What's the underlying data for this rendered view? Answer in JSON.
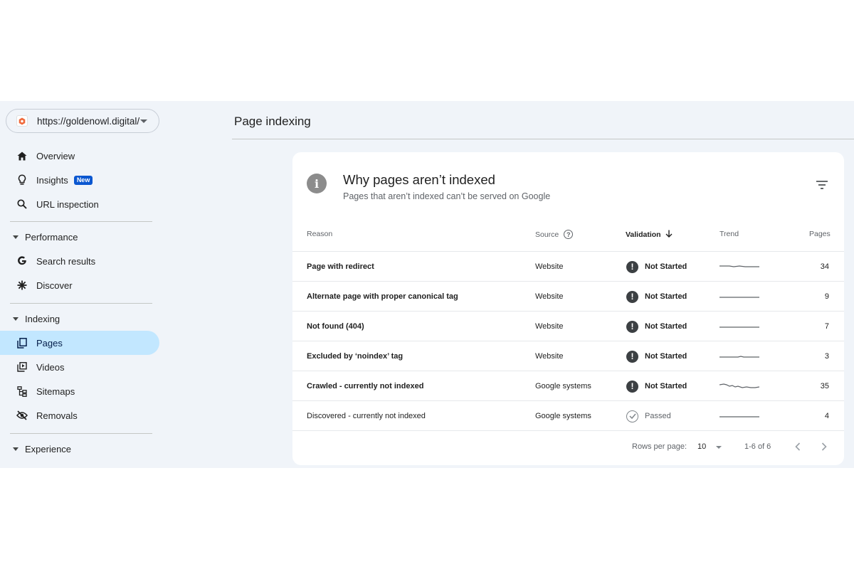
{
  "property": {
    "url": "https://goldenowl.digital/"
  },
  "sidebar": {
    "items": [
      {
        "label": "Overview",
        "icon": "home-icon"
      },
      {
        "label": "Insights",
        "icon": "lightbulb-icon",
        "badge": "New"
      },
      {
        "label": "URL inspection",
        "icon": "search-icon"
      }
    ],
    "performance": {
      "label": "Performance",
      "items": [
        {
          "label": "Search results",
          "icon": "google-g-icon"
        },
        {
          "label": "Discover",
          "icon": "asterisk-icon"
        }
      ]
    },
    "indexing": {
      "label": "Indexing",
      "items": [
        {
          "label": "Pages",
          "icon": "pages-icon"
        },
        {
          "label": "Videos",
          "icon": "video-icon"
        },
        {
          "label": "Sitemaps",
          "icon": "sitemap-icon"
        },
        {
          "label": "Removals",
          "icon": "eye-off-icon"
        }
      ]
    },
    "experience": {
      "label": "Experience"
    }
  },
  "header": {
    "title": "Page indexing"
  },
  "card": {
    "title": "Why pages aren’t indexed",
    "subtitle": "Pages that aren’t indexed can’t be served on Google",
    "columns": {
      "reason": "Reason",
      "source": "Source",
      "validation": "Validation",
      "trend": "Trend",
      "pages": "Pages"
    },
    "rows": [
      {
        "reason": "Page with redirect",
        "source": "Website",
        "validation": "Not Started",
        "pages": "34"
      },
      {
        "reason": "Alternate page with proper canonical tag",
        "source": "Website",
        "validation": "Not Started",
        "pages": "9"
      },
      {
        "reason": "Not found (404)",
        "source": "Website",
        "validation": "Not Started",
        "pages": "7"
      },
      {
        "reason": "Excluded by ‘noindex’ tag",
        "source": "Website",
        "validation": "Not Started",
        "pages": "3"
      },
      {
        "reason": "Crawled - currently not indexed",
        "source": "Google systems",
        "validation": "Not Started",
        "pages": "35"
      },
      {
        "reason": "Discovered - currently not indexed",
        "source": "Google systems",
        "validation": "Passed",
        "pages": "4"
      }
    ],
    "footer": {
      "rows_label": "Rows per page:",
      "rows_value": "10",
      "range": "1-6 of 6"
    }
  },
  "colors": {
    "background": "#f0f4f9",
    "active_nav": "#c2e7ff",
    "badge": "#0b57d0"
  }
}
